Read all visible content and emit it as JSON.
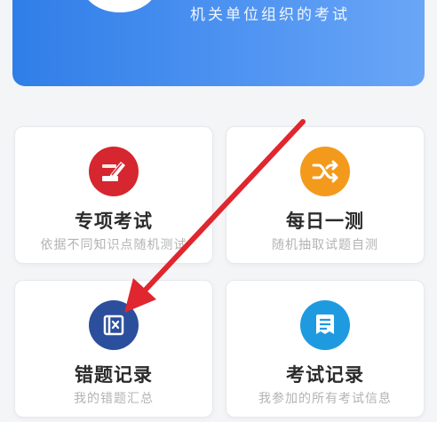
{
  "banner": {
    "subtitle": "机关单位组织的考试"
  },
  "cards": [
    {
      "id": "zxks",
      "title": "专项考试",
      "desc": "依据不同知识点随机测试",
      "color": "#d6262f",
      "icon": "pencil-card-icon"
    },
    {
      "id": "mryc",
      "title": "每日一测",
      "desc": "随机抽取试题自测",
      "color": "#f39a1c",
      "icon": "shuffle-icon"
    },
    {
      "id": "ctjl",
      "title": "错题记录",
      "desc": "我的错题汇总",
      "color": "#2b4f9c",
      "icon": "wrong-book-icon"
    },
    {
      "id": "ksjl",
      "title": "考试记录",
      "desc": "我参加的所有考试信息",
      "color": "#1e9be0",
      "icon": "document-list-icon"
    }
  ],
  "annotation": {
    "arrow_color": "#e0262e"
  }
}
